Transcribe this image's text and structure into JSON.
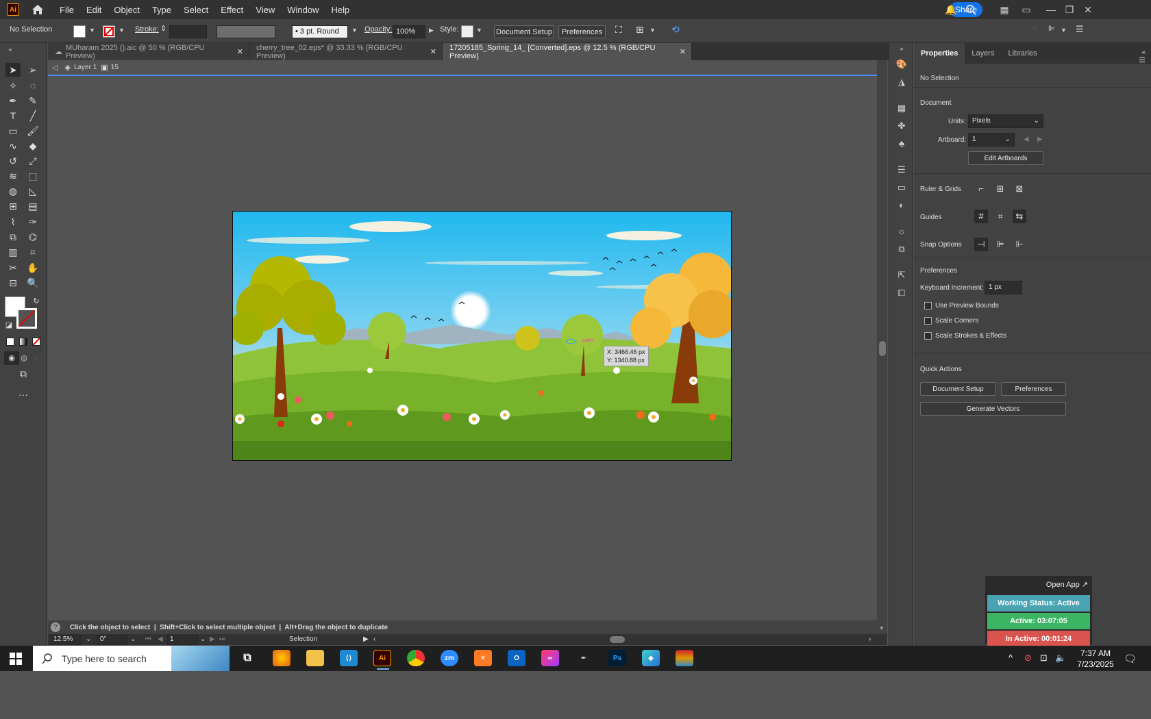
{
  "app": {
    "logo": "Ai",
    "menus": [
      "File",
      "Edit",
      "Object",
      "Type",
      "Select",
      "Effect",
      "View",
      "Window",
      "Help"
    ],
    "share_label": "Share"
  },
  "control_bar": {
    "selection": "No Selection",
    "stroke_label": "Stroke:",
    "brush": "3 pt. Round",
    "opacity_label": "Opacity:",
    "opacity_value": "100%",
    "style_label": "Style:",
    "document_setup": "Document Setup",
    "preferences": "Preferences"
  },
  "tabs": [
    {
      "label": "MUharam 2025 ().aic @ 50 % (RGB/CPU Preview)",
      "active": false
    },
    {
      "label": "cherry_tree_02.eps* @ 33.33 % (RGB/CPU Preview)",
      "active": false
    },
    {
      "label": "17205185_Spring_14_ [Converted].eps @ 12.5 % (RGB/CPU Preview)",
      "active": true
    }
  ],
  "layer_bar": {
    "layer": "Layer 1",
    "count": "15"
  },
  "cursor_tooltip": {
    "x": "X: 3466.46 px",
    "y": "Y: 1340.88 px"
  },
  "hint": "Click the object to select  |  Shift+Click to select multiple object  |  Alt+Drag the object to duplicate",
  "status_bar": {
    "zoom": "12.5%",
    "rotation": "0°",
    "artboard": "1",
    "tool": "Selection"
  },
  "properties": {
    "tabs": [
      "Properties",
      "Layers",
      "Libraries"
    ],
    "selection": "No Selection",
    "document_heading": "Document",
    "units_label": "Units:",
    "units_value": "Pixels",
    "artboard_label": "Artboard:",
    "artboard_value": "1",
    "edit_artboards": "Edit Artboards",
    "rulers_grids": "Ruler & Grids",
    "guides": "Guides",
    "snap_options": "Snap Options",
    "preferences_heading": "Preferences",
    "keyboard_increment_label": "Keyboard Increment:",
    "keyboard_increment_value": "1 px",
    "use_preview_bounds": "Use Preview Bounds",
    "scale_corners": "Scale Corners",
    "scale_strokes": "Scale Strokes & Effects",
    "quick_actions": "Quick Actions",
    "document_setup": "Document Setup",
    "preferences": "Preferences",
    "generate_vectors": "Generate Vectors"
  },
  "widget": {
    "open_app": "Open App ↗",
    "working_status": "Working Status: Active",
    "active": "Active: 03:07:05",
    "inactive": "In Active: 00:01:24",
    "colors": {
      "working": "#4aa3b3",
      "active": "#3bb563",
      "inactive": "#d9534f"
    }
  },
  "taskbar": {
    "search_placeholder": "Type here to search",
    "time": "7:37 AM",
    "date": "7/23/2025",
    "apps": [
      "firefox-icon",
      "file-explorer-icon",
      "vscode-icon",
      "illustrator-icon",
      "chrome-icon",
      "zoom-icon",
      "xampp-icon",
      "outlook-icon",
      "creative-cloud-icon",
      "pen-tool-icon",
      "photoshop-icon",
      "app-icon",
      "winrar-icon"
    ]
  }
}
